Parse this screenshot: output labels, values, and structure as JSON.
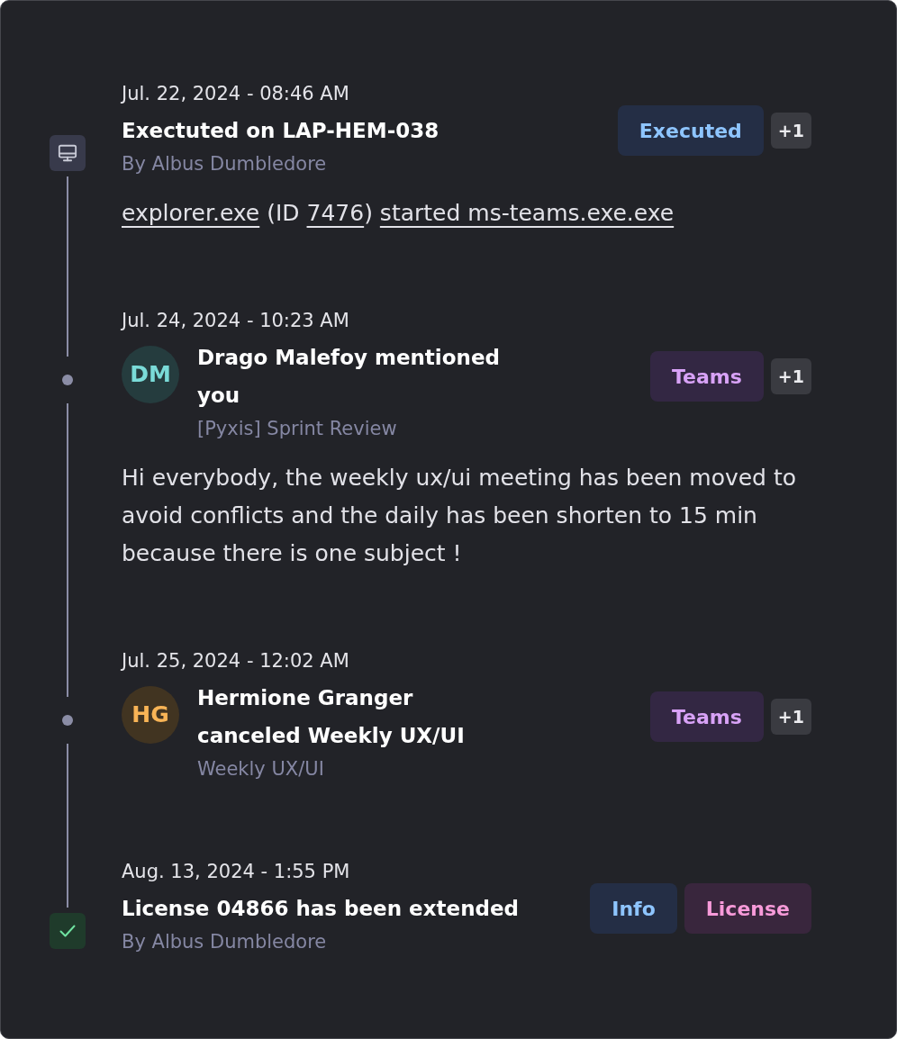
{
  "events": [
    {
      "kind": "monitor",
      "date": "Jul. 22, 2024 - 08:46 AM",
      "title": "Exectuted on LAP-HEM-038",
      "subtitle": "By Albus Dumbledore",
      "tags": [
        {
          "label": "Executed",
          "color": "#8ec5ff"
        }
      ],
      "more": "+1",
      "body": [
        {
          "text": "explorer.exe",
          "link": true
        },
        {
          "text": " (ID ",
          "link": false
        },
        {
          "text": "7476",
          "link": true
        },
        {
          "text": ") ",
          "link": false
        },
        {
          "text": "started ms-teams.exe.exe",
          "link": true
        }
      ]
    },
    {
      "kind": "dot",
      "date": "Jul. 24, 2024 - 10:23 AM",
      "avatar": {
        "initials": "DM",
        "color": "#7adbd8"
      },
      "title": "Drago Malefoy mentioned you",
      "subtitle": "[Pyxis] Sprint Review",
      "tags": [
        {
          "label": "Teams",
          "color": "#d8a2f7"
        }
      ],
      "more": "+1",
      "body": [
        {
          "text": "Hi everybody, the weekly ux/ui meeting has been moved to avoid conflicts and the daily has been shorten to 15 min because there is one subject !",
          "link": false
        }
      ]
    },
    {
      "kind": "dot",
      "date": "Jul. 25, 2024 - 12:02 AM",
      "avatar": {
        "initials": "HG",
        "color": "#f8b456"
      },
      "title": "Hermione Granger canceled Weekly UX/UI",
      "subtitle": "Weekly UX/UI",
      "tags": [
        {
          "label": "Teams",
          "color": "#d8a2f7"
        }
      ],
      "more": "+1"
    },
    {
      "kind": "check",
      "date": "Aug. 13, 2024 - 1:55 PM",
      "title": "License 04866 has been extended",
      "subtitle": "By Albus Dumbledore",
      "tags": [
        {
          "label": "Info",
          "color": "#8ec5ff"
        },
        {
          "label": "License",
          "color": "#f79ad9"
        }
      ]
    }
  ]
}
